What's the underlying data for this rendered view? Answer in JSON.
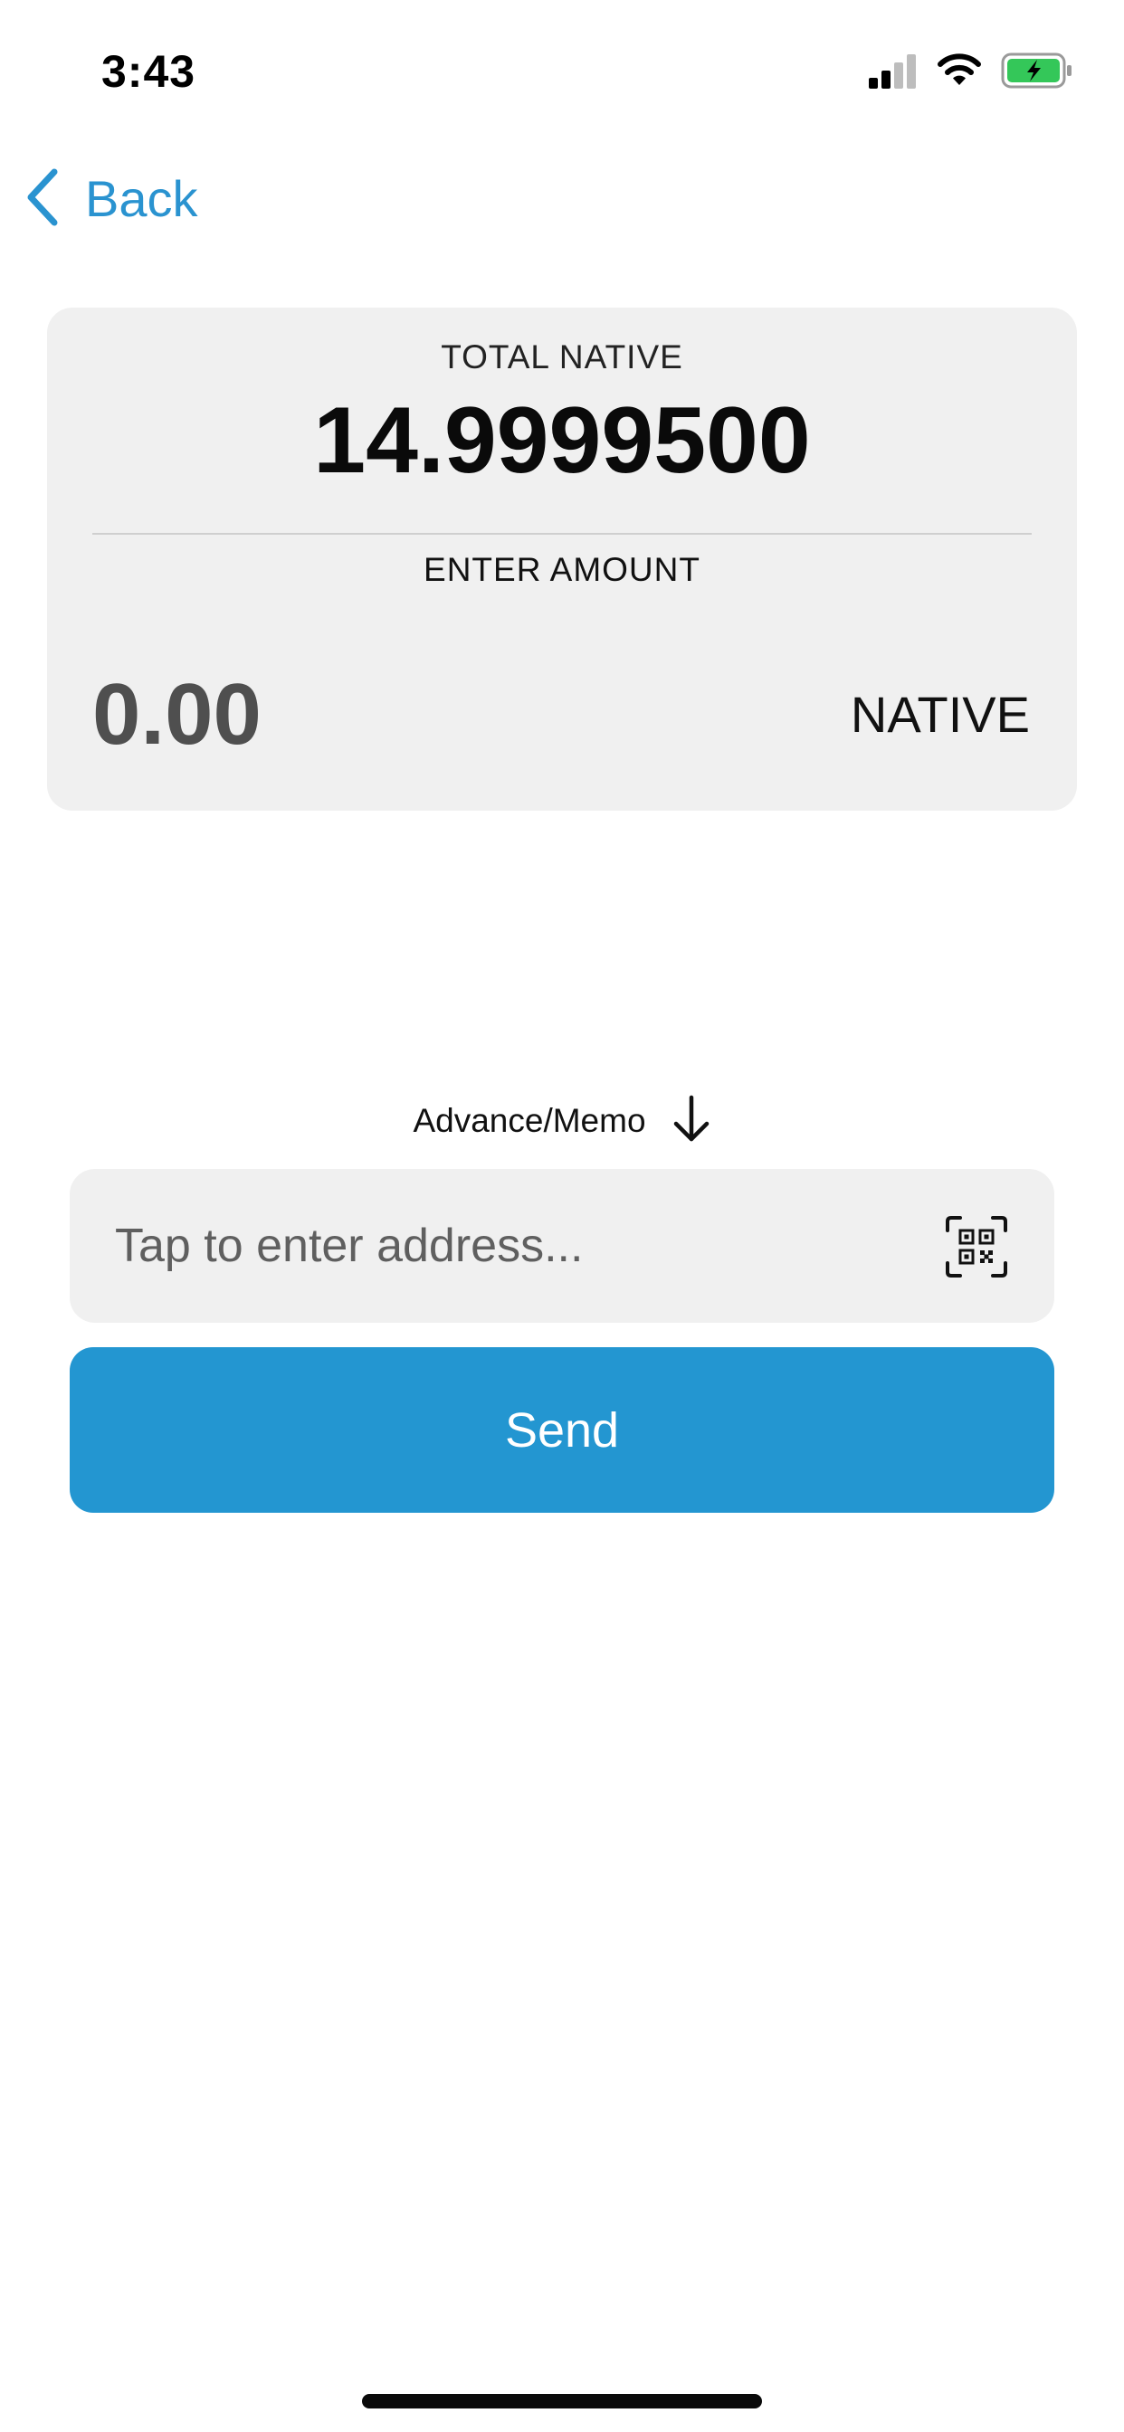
{
  "status_bar": {
    "time": "3:43"
  },
  "nav": {
    "back_label": "Back"
  },
  "balance": {
    "total_label": "TOTAL NATIVE",
    "total_value": "14.9999500"
  },
  "amount": {
    "label": "ENTER AMOUNT",
    "value": "0.00",
    "currency": "NATIVE"
  },
  "advance": {
    "label": "Advance/Memo"
  },
  "address": {
    "placeholder": "Tap to enter address..."
  },
  "send": {
    "label": "Send"
  },
  "colors": {
    "accent": "#2396D1",
    "card_bg": "#F0F0F0",
    "battery_charging": "#34C759"
  },
  "icons": [
    "cellular-signal-icon",
    "wifi-icon",
    "battery-charging-icon",
    "chevron-left-icon",
    "arrow-down-icon",
    "qr-scan-icon"
  ]
}
